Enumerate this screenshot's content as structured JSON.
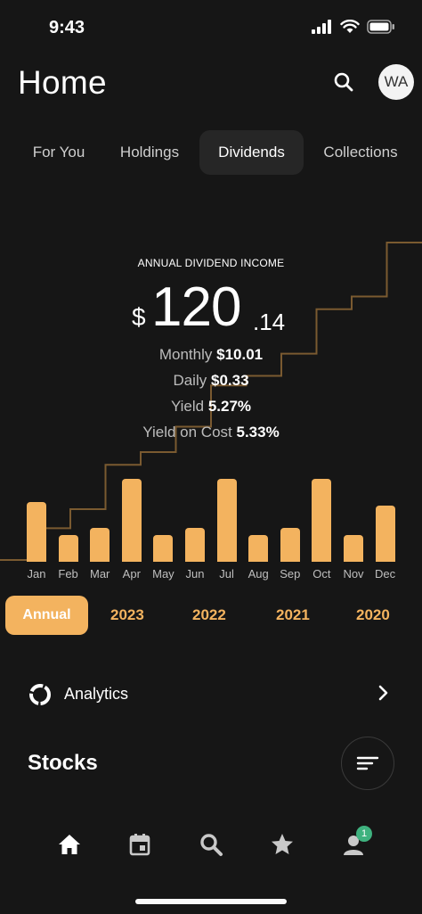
{
  "status_bar": {
    "time": "9:43"
  },
  "header": {
    "title": "Home",
    "avatar_initials": "WA"
  },
  "tabs": [
    {
      "label": "For You",
      "active": false
    },
    {
      "label": "Holdings",
      "active": false
    },
    {
      "label": "Dividends",
      "active": true
    },
    {
      "label": "Collections",
      "active": false
    }
  ],
  "income": {
    "label": "ANNUAL DIVIDEND INCOME",
    "currency": "$",
    "whole": "120",
    "decimal": ".14"
  },
  "stats": [
    {
      "label": "Monthly",
      "value": "$10.01"
    },
    {
      "label": "Daily",
      "value": "$0.33"
    },
    {
      "label": "Yield",
      "value": "5.27%"
    },
    {
      "label": "Yield on Cost",
      "value": "5.33%"
    }
  ],
  "chart_data": {
    "type": "bar",
    "categories": [
      "Jan",
      "Feb",
      "Mar",
      "Apr",
      "May",
      "Jun",
      "Jul",
      "Aug",
      "Sep",
      "Oct",
      "Nov",
      "Dec"
    ],
    "values": [
      0.72,
      0.32,
      0.41,
      1.0,
      0.32,
      0.41,
      1.0,
      0.32,
      0.41,
      1.0,
      0.32,
      0.68
    ],
    "cumulative_line": [
      0.0,
      0.1,
      0.16,
      0.3,
      0.34,
      0.42,
      0.55,
      0.58,
      0.65,
      0.79,
      0.83,
      1.0
    ],
    "bar_color": "#f3b35f",
    "line_color": "#7a5a30"
  },
  "year_selector": {
    "annual_label": "Annual",
    "years": [
      "2023",
      "2022",
      "2021",
      "2020"
    ],
    "accent_color": "#f3b35f"
  },
  "analytics": {
    "label": "Analytics",
    "icon": "donut-chart-icon"
  },
  "stocks": {
    "title": "Stocks"
  },
  "bottom_nav": {
    "items": [
      "home-icon",
      "calendar-icon",
      "search-icon",
      "star-icon",
      "profile-icon"
    ],
    "badge_count": "1",
    "badge_color": "#3fb27f"
  }
}
